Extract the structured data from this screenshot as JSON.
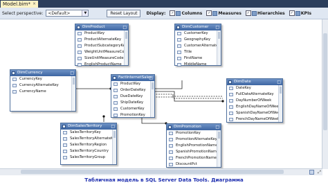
{
  "tab": {
    "title": "Model.bim*",
    "close": "×"
  },
  "toolbar": {
    "perspective_label": "Select perspective:",
    "perspective_value": "<Default>",
    "reset_label": "Reset Layout",
    "display_label": "Display:",
    "options": [
      {
        "label": "Columns",
        "checked": true
      },
      {
        "label": "Measures",
        "checked": true
      },
      {
        "label": "Hierarchies",
        "checked": true
      },
      {
        "label": "KPIs",
        "checked": true
      }
    ]
  },
  "tables": {
    "dim_product": {
      "name": "DimProduct",
      "columns": [
        "ProductKey",
        "ProductAlternateKey",
        "ProductSubcategoryKey",
        "WeightUnitMeasureCode",
        "SizeUnitMeasureCode",
        "EnglishProductName"
      ]
    },
    "dim_customer": {
      "name": "DimCustomer",
      "columns": [
        "CustomerKey",
        "GeographyKey",
        "CustomerAlternateKey",
        "Title",
        "FirstName",
        "MiddleName"
      ]
    },
    "dim_currency": {
      "name": "DimCurrency",
      "columns": [
        "CurrencyKey",
        "CurrencyAlternateKey",
        "CurrencyName"
      ]
    },
    "fact_internet_sales": {
      "name": "FactInternetSales",
      "columns": [
        "ProductKey",
        "OrderDateKey",
        "DueDateKey",
        "ShipDateKey",
        "CustomerKey",
        "PromotionKey"
      ]
    },
    "dim_date": {
      "name": "DimDate",
      "columns": [
        "DateKey",
        "FullDateAlternateKey",
        "DayNumberOfWeek",
        "EnglishDayNameOfWeek",
        "SpanishDayNameOfWeek",
        "FrenchDayNameOfWeek"
      ]
    },
    "dim_sales_territory": {
      "name": "DimSalesTerritory",
      "columns": [
        "SalesTerritoryKey",
        "SalesTerritoryAlternateKey",
        "SalesTerritoryRegion",
        "SalesTerritoryCountry",
        "SalesTerritoryGroup"
      ]
    },
    "dim_promotion": {
      "name": "DimPromotion",
      "columns": [
        "PromotionKey",
        "PromotionAlternateKey",
        "EnglishPromotionName",
        "SpanishPromotionName",
        "FrenchPromotionName",
        "DiscountPct"
      ]
    }
  },
  "caption": "Табличная модель в SQL Server Data Tools. Диаграмма",
  "colors": {
    "header": "#3d66a2",
    "tab_strip": "#2b3e5c",
    "caption": "#2030b0"
  }
}
